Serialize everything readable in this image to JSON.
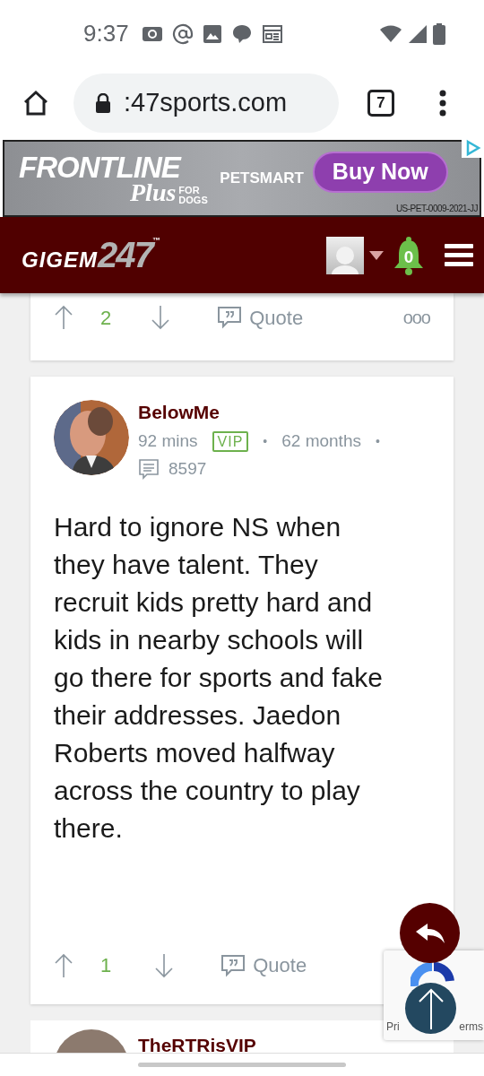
{
  "status_bar": {
    "time": "9:37"
  },
  "browser": {
    "url": ":47sports.com",
    "tab_count": "7"
  },
  "ad": {
    "brand": "FRONTLINE",
    "brand_sub": "Plus",
    "brand_tag": "FOR DOGS",
    "store": "PETSMART",
    "cta": "Buy Now",
    "code": "US-PET-0009-2021-JJ"
  },
  "site_header": {
    "logo_word": "GIGEM",
    "logo_number": "247",
    "logo_mark": "™",
    "notifications": "0"
  },
  "posts": [
    {
      "kind": "tail",
      "votes": "2",
      "quote": "Quote",
      "more": "ooo"
    },
    {
      "kind": "full",
      "author": "BelowMe",
      "time": "92 mins",
      "badge": "VIP",
      "tenure": "62 months",
      "separators": [
        "•",
        "•"
      ],
      "post_count": "8597",
      "body": "Hard to ignore NS when they have talent. They recruit kids pretty hard and kids in nearby schools will go there for sports and fake their addresses. Jaedon Roberts moved halfway across the country to play there.",
      "votes": "1",
      "quote": "Quote"
    },
    {
      "kind": "head",
      "author": "TheRTRisVIP"
    }
  ],
  "recaptcha": {
    "left": "Pri",
    "right": "erms"
  }
}
